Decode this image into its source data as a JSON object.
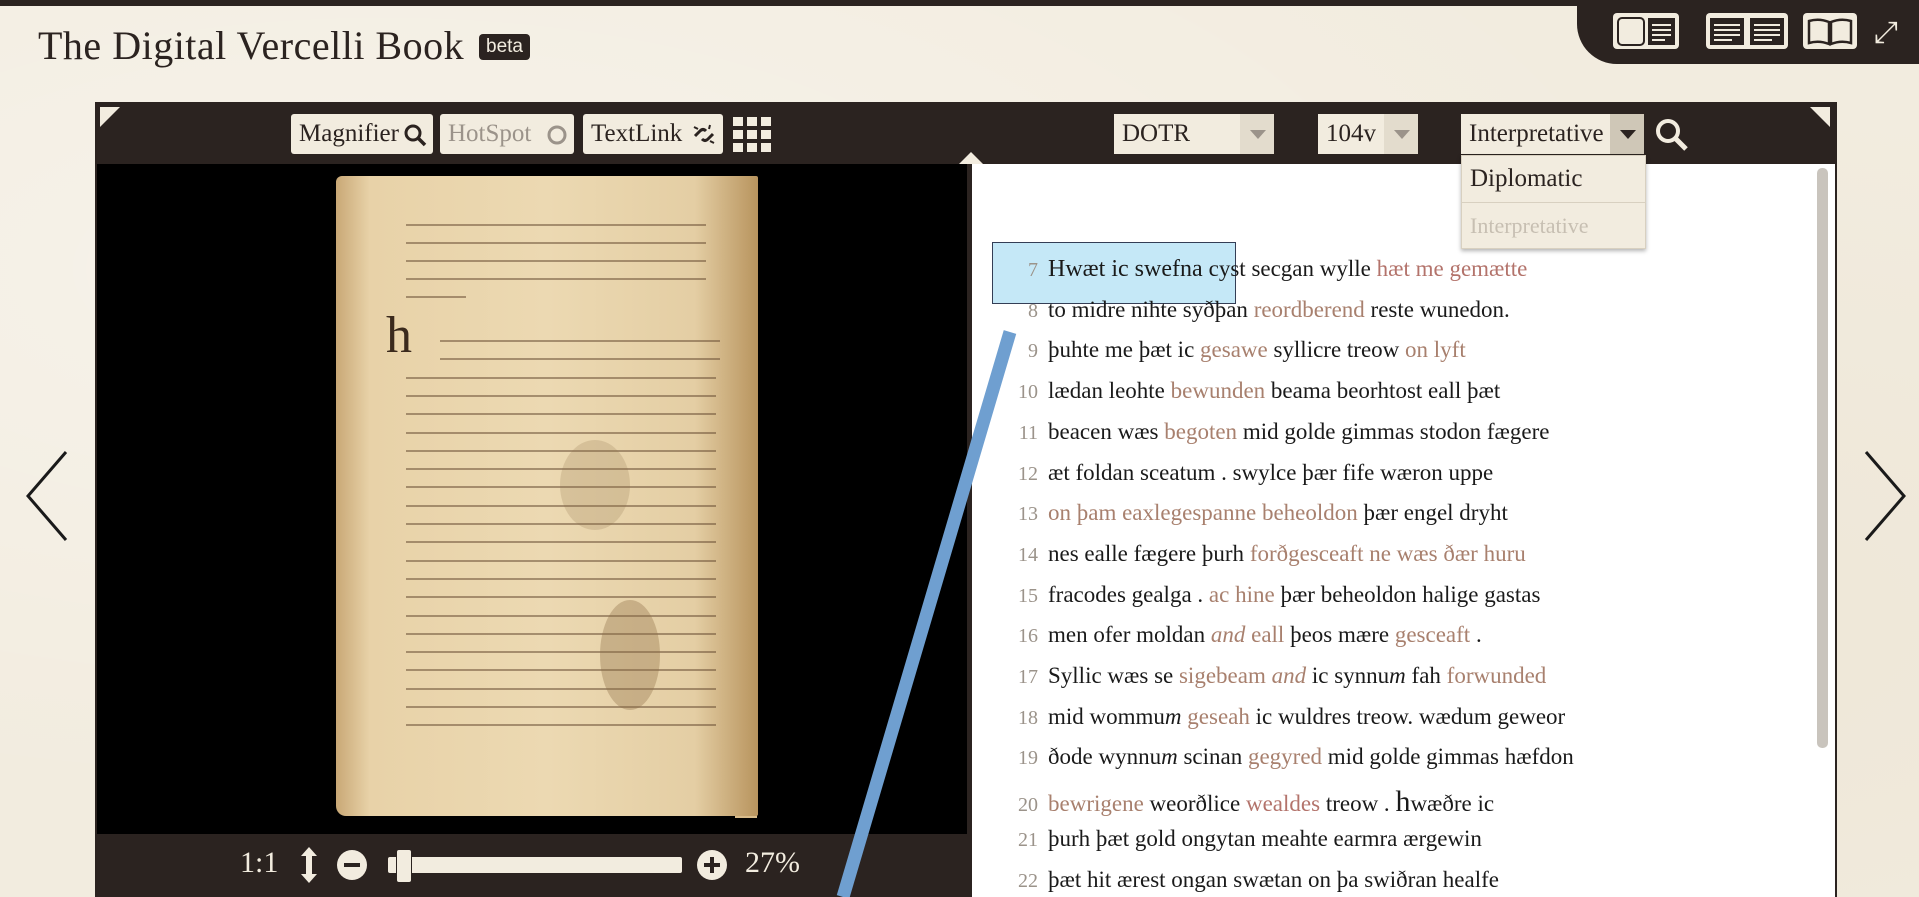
{
  "app": {
    "title": "The Digital Vercelli Book",
    "badge": "beta"
  },
  "view_tabs": [
    {
      "name": "image-text-view",
      "label": ""
    },
    {
      "name": "text-text-view",
      "label": ""
    },
    {
      "name": "book-view",
      "label": ""
    }
  ],
  "image_toolbar": {
    "magnifier": "Magnifier",
    "hotspot": "HotSpot",
    "textlink": "TextLink"
  },
  "text_toolbar": {
    "document": "DOTR",
    "page": "104v",
    "edition_level": "Interpretative",
    "edition_options": [
      "Diplomatic",
      "Interpretative"
    ]
  },
  "zoom": {
    "reset": "1:1",
    "percent": "27%",
    "level": 0.03
  },
  "colors": {
    "frame": "#2b2320",
    "paper": "#f2ecdf",
    "highlight": "#bfe6f7",
    "link_line": "#6f9fd0",
    "modified_text": "#a8806e"
  },
  "text_lines": [
    {
      "n": "7",
      "parts": [
        {
          "t": "Hwæt ic swefna ",
          "s": "first"
        },
        {
          "t": "cyst secgan wylle ",
          "s": ""
        },
        {
          "t": "hæt me gemætte",
          "s": "mod2"
        }
      ]
    },
    {
      "n": "8",
      "parts": [
        {
          "t": "to midre nihte syðþan ",
          "s": ""
        },
        {
          "t": "reordberend",
          "s": "mod"
        },
        {
          "t": " reste wunedon.",
          "s": ""
        }
      ]
    },
    {
      "n": "9",
      "parts": [
        {
          "t": "þuhte me þæt ic ",
          "s": ""
        },
        {
          "t": "gesawe",
          "s": "mod"
        },
        {
          "t": " syllicre treow ",
          "s": ""
        },
        {
          "t": "on lyft",
          "s": "mod"
        }
      ]
    },
    {
      "n": "10",
      "parts": [
        {
          "t": "lædan leohte ",
          "s": ""
        },
        {
          "t": "bewunden",
          "s": "mod"
        },
        {
          "t": " beama beorhtost eall þæt",
          "s": ""
        }
      ]
    },
    {
      "n": "11",
      "parts": [
        {
          "t": "beacen wæs ",
          "s": ""
        },
        {
          "t": "begoten",
          "s": "mod"
        },
        {
          "t": " mid golde gimmas stodon fægere",
          "s": ""
        }
      ]
    },
    {
      "n": "12",
      "parts": [
        {
          "t": "æt foldan sceatum . swylce þær fife wæron uppe",
          "s": ""
        }
      ]
    },
    {
      "n": "13",
      "parts": [
        {
          "t": "on þam eaxlegespanne beheoldon",
          "s": "mod"
        },
        {
          "t": " þær engel dryht",
          "s": ""
        }
      ]
    },
    {
      "n": "14",
      "parts": [
        {
          "t": "nes ealle fægere þurh ",
          "s": ""
        },
        {
          "t": "forðgesceaft ne wæs ðær huru",
          "s": "mod"
        }
      ]
    },
    {
      "n": "15",
      "parts": [
        {
          "t": "fracodes gealga . ",
          "s": ""
        },
        {
          "t": "ac hine",
          "s": "mod"
        },
        {
          "t": " þær beheoldon halige gastas",
          "s": ""
        }
      ]
    },
    {
      "n": "16",
      "parts": [
        {
          "t": "men ofer moldan ",
          "s": ""
        },
        {
          "t": "and",
          "s": "modit"
        },
        {
          "t": " eall",
          "s": "mod"
        },
        {
          "t": " þeos mære ",
          "s": ""
        },
        {
          "t": "gesceaft",
          "s": "mod"
        },
        {
          "t": " .",
          "s": ""
        }
      ]
    },
    {
      "n": "17",
      "parts": [
        {
          "t": "Syllic wæs se ",
          "s": ""
        },
        {
          "t": "sigebeam",
          "s": "mod"
        },
        {
          "t": " and",
          "s": "modit"
        },
        {
          "t": " ic synnu",
          "s": ""
        },
        {
          "t": "m",
          "s": "it"
        },
        {
          "t": " fah ",
          "s": ""
        },
        {
          "t": "forwunded",
          "s": "mod"
        }
      ]
    },
    {
      "n": "18",
      "parts": [
        {
          "t": "mid wommu",
          "s": ""
        },
        {
          "t": "m",
          "s": "it"
        },
        {
          "t": " ",
          "s": ""
        },
        {
          "t": "geseah",
          "s": "mod"
        },
        {
          "t": " ic wuldres treow. wædum geweor",
          "s": ""
        }
      ]
    },
    {
      "n": "19",
      "parts": [
        {
          "t": "ðode wynnu",
          "s": ""
        },
        {
          "t": "m",
          "s": "it"
        },
        {
          "t": " scinan ",
          "s": ""
        },
        {
          "t": "gegyred",
          "s": "mod"
        },
        {
          "t": " mid golde gimmas hæfdon",
          "s": ""
        }
      ]
    },
    {
      "n": "20",
      "parts": [
        {
          "t": "bewrigene",
          "s": "mod"
        },
        {
          "t": " weorðlice ",
          "s": ""
        },
        {
          "t": "wealdes",
          "s": "mod2"
        },
        {
          "t": " treow . ",
          "s": ""
        },
        {
          "t": "h",
          "s": "big"
        },
        {
          "t": "wæðre ic",
          "s": ""
        }
      ]
    },
    {
      "n": "21",
      "parts": [
        {
          "t": "þurh þæt gold ongytan meahte earmra ærgewin",
          "s": ""
        }
      ]
    },
    {
      "n": "22",
      "parts": [
        {
          "t": "þæt hit ærest ongan swætan on þa swiðran healfe",
          "s": ""
        }
      ]
    }
  ]
}
